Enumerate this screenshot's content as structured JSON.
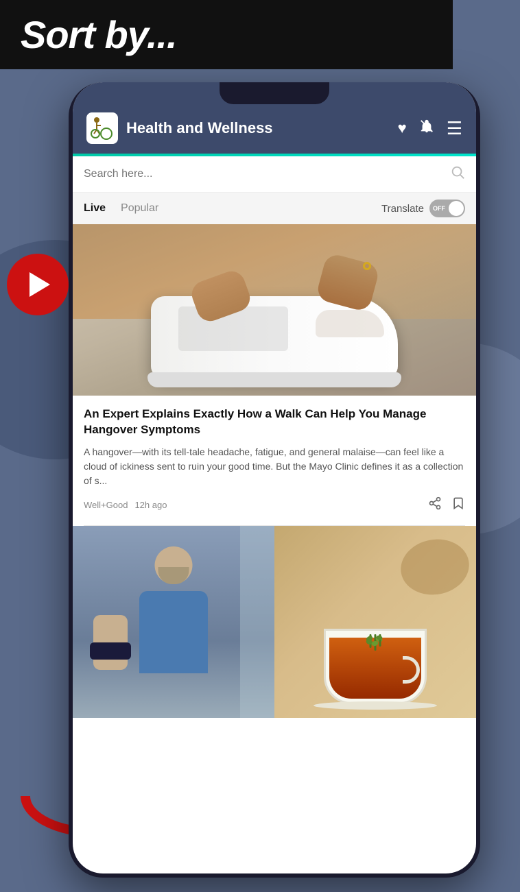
{
  "background": {
    "color": "#5a6a8a"
  },
  "sort_header": {
    "text": "Sort by..."
  },
  "play_button": {
    "label": "Play"
  },
  "phone": {
    "app_header": {
      "title": "Health and Wellness",
      "logo_alt": "Health and Wellness logo",
      "heart_icon": "♥",
      "bell_icon": "🔔",
      "menu_icon": "☰"
    },
    "search": {
      "placeholder": "Search here..."
    },
    "tabs": [
      {
        "label": "Live",
        "active": true
      },
      {
        "label": "Popular",
        "active": false
      }
    ],
    "translate": {
      "label": "Translate",
      "state": "OFF"
    },
    "article1": {
      "title": "An Expert Explains Exactly How a Walk Can Help You Manage Hangover Symptoms",
      "excerpt": "A hangover—with its tell-tale headache, fatigue, and general malaise—can feel like a cloud of ickiness sent to ruin your good time. But the Mayo Clinic defines it as a collection of s...",
      "source": "Well+Good",
      "time": "12h ago",
      "share_icon": "share",
      "bookmark_icon": "bookmark"
    }
  }
}
